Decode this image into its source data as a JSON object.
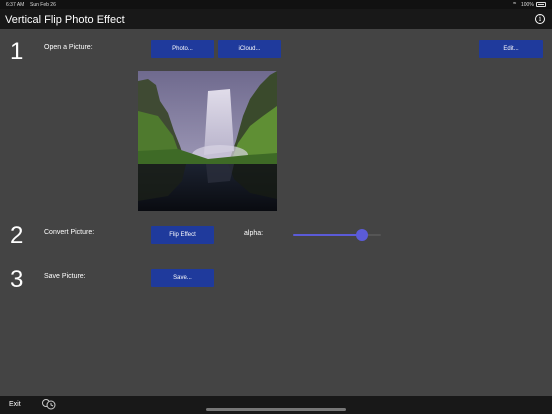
{
  "status_bar": {
    "time": "6:37 AM",
    "date": "Sun Feb 26",
    "battery": "100%"
  },
  "app": {
    "title": "Vertical Flip Photo Effect"
  },
  "steps": [
    {
      "number": "1",
      "label": "Open a Picture:"
    },
    {
      "number": "2",
      "label": "Convert Picture:"
    },
    {
      "number": "3",
      "label": "Save Picture:"
    }
  ],
  "buttons": {
    "photo": "Photo...",
    "icloud": "iCloud...",
    "edit": "Edit...",
    "flip_effect": "Flip Effect",
    "save": "Save..."
  },
  "alpha": {
    "label": "alpha:",
    "value": 0.78
  },
  "bottom": {
    "exit_label": "Exit"
  },
  "colors": {
    "button": "#1f3a9c",
    "slider": "#5b5bd8",
    "background": "#444444",
    "bar": "#181818"
  },
  "icons": {
    "info": "info-icon",
    "history": "history-icon",
    "wifi": "wifi-icon",
    "battery": "battery-icon"
  }
}
